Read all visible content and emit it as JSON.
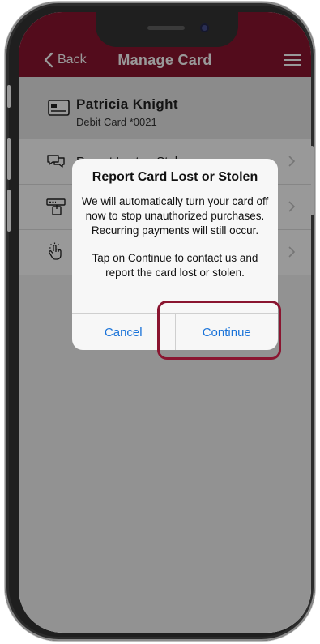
{
  "nav": {
    "back_label": "Back",
    "title": "Manage Card",
    "back_icon": "chevron-left-icon",
    "menu_icon": "hamburger-menu-icon"
  },
  "card": {
    "name": "Patricia Knight",
    "number": "Debit Card *0021",
    "icon": "debit-card-icon"
  },
  "menu": {
    "items": [
      {
        "label": "Report Lost or Stolen",
        "icon": "chat-bubbles-icon"
      },
      {
        "label": "",
        "icon": "card-reader-icon"
      },
      {
        "label": "",
        "icon": "tap-hand-icon"
      }
    ]
  },
  "alert": {
    "title": "Report Card Lost or Stolen",
    "message_line1": "We will automatically turn your card off now to stop unauthorized purchases.",
    "message_line2": "Recurring payments will still occur.",
    "message_line3": "Tap on Continue to contact us and report the card lost or stolen.",
    "cancel_label": "Cancel",
    "continue_label": "Continue"
  },
  "colors": {
    "brand": "#8a1530",
    "link": "#1a73d9",
    "overlay": "rgba(0,0,0,0.40)"
  }
}
